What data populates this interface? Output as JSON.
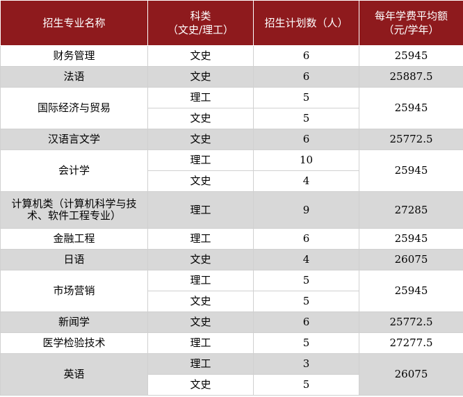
{
  "headers": {
    "major": "招生专业名称",
    "category_line1": "科类",
    "category_line2": "（文史/理工）",
    "plan": "招生计划数（人）",
    "fee_line1": "每年学费平均额",
    "fee_line2": "（元/学年）"
  },
  "rows": [
    {
      "major": "财务管理",
      "category": "文史",
      "plan": "6",
      "fee": "25945"
    },
    {
      "major": "法语",
      "category": "文史",
      "plan": "6",
      "fee": "25887.5"
    },
    {
      "major": "国际经济与贸易",
      "category": "理工",
      "plan": "5",
      "fee": "25945"
    },
    {
      "category": "文史",
      "plan": "5"
    },
    {
      "major": "汉语言文学",
      "category": "文史",
      "plan": "6",
      "fee": "25772.5"
    },
    {
      "major": "会计学",
      "category": "理工",
      "plan": "10",
      "fee": "25945"
    },
    {
      "category": "文史",
      "plan": "4"
    },
    {
      "major": "计算机类（计算机科学与技术、软件工程专业）",
      "category": "理工",
      "plan": "9",
      "fee": "27285"
    },
    {
      "major": "金融工程",
      "category": "理工",
      "plan": "6",
      "fee": "25945"
    },
    {
      "major": "日语",
      "category": "文史",
      "plan": "4",
      "fee": "26075"
    },
    {
      "major": "市场营销",
      "category": "理工",
      "plan": "5",
      "fee": "25945"
    },
    {
      "category": "文史",
      "plan": "5"
    },
    {
      "major": "新闻学",
      "category": "文史",
      "plan": "6",
      "fee": "25772.5"
    },
    {
      "major": "医学检验技术",
      "category": "理工",
      "plan": "5",
      "fee": "27277.5"
    },
    {
      "major": "英语",
      "category": "理工",
      "plan": "3",
      "fee": "26075"
    },
    {
      "category": "文史",
      "plan": "5"
    }
  ],
  "colors": {
    "header_bg": "#8e1a1d",
    "header_text": "#ffffff",
    "shaded_row": "#d8d8d8",
    "plain_row": "#ffffff"
  }
}
